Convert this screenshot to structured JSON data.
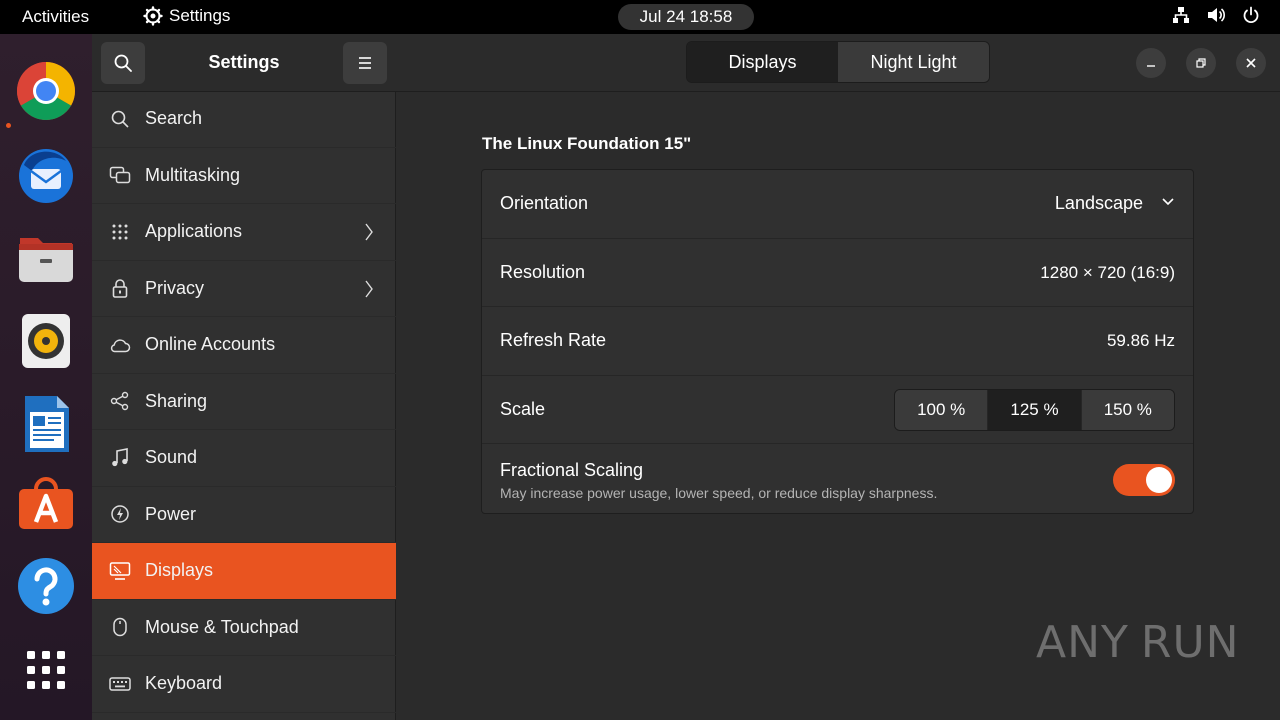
{
  "topbar": {
    "activities": "Activities",
    "app_name": "Settings",
    "clock": "Jul 24  18:58"
  },
  "dock": {
    "items": [
      {
        "icon": "chrome-icon"
      },
      {
        "icon": "thunderbird-icon"
      },
      {
        "icon": "files-icon"
      },
      {
        "icon": "rhythmbox-icon"
      },
      {
        "icon": "libreoffice-writer-icon"
      },
      {
        "icon": "app-center-icon"
      },
      {
        "icon": "help-icon"
      },
      {
        "icon": "show-apps-icon"
      }
    ]
  },
  "sidebar": {
    "title": "Settings",
    "items": [
      {
        "label": "Search",
        "icon": "search-icon",
        "chevron": false,
        "active": false
      },
      {
        "label": "Multitasking",
        "icon": "multitasking-icon",
        "chevron": false,
        "active": false
      },
      {
        "label": "Applications",
        "icon": "apps-grid-icon",
        "chevron": true,
        "active": false
      },
      {
        "label": "Privacy",
        "icon": "lock-icon",
        "chevron": true,
        "active": false
      },
      {
        "label": "Online Accounts",
        "icon": "cloud-icon",
        "chevron": false,
        "active": false
      },
      {
        "label": "Sharing",
        "icon": "share-icon",
        "chevron": false,
        "active": false
      },
      {
        "label": "Sound",
        "icon": "music-note-icon",
        "chevron": false,
        "active": false
      },
      {
        "label": "Power",
        "icon": "power-icon",
        "chevron": false,
        "active": false
      },
      {
        "label": "Displays",
        "icon": "display-icon",
        "chevron": false,
        "active": true
      },
      {
        "label": "Mouse & Touchpad",
        "icon": "mouse-icon",
        "chevron": false,
        "active": false
      },
      {
        "label": "Keyboard",
        "icon": "keyboard-icon",
        "chevron": false,
        "active": false
      }
    ]
  },
  "header": {
    "tabs": [
      {
        "label": "Displays",
        "active": true
      },
      {
        "label": "Night Light",
        "active": false
      }
    ]
  },
  "display": {
    "name": "The Linux Foundation 15\"",
    "orientation": {
      "label": "Orientation",
      "value": "Landscape"
    },
    "resolution": {
      "label": "Resolution",
      "value": "1280 × 720 (16:9)"
    },
    "refresh": {
      "label": "Refresh Rate",
      "value": "59.86 Hz"
    },
    "scale": {
      "label": "Scale",
      "options": [
        "100 %",
        "125 %",
        "150 %"
      ],
      "selected": "125 %"
    },
    "fractional": {
      "label": "Fractional Scaling",
      "description": "May increase power usage, lower speed, or reduce display sharpness.",
      "enabled": true
    }
  },
  "watermark": {
    "left": "ANY",
    "right": "RUN"
  },
  "colors": {
    "accent": "#e95420",
    "sidebar_bg": "#303030",
    "content_bg": "#2b2b2b"
  }
}
